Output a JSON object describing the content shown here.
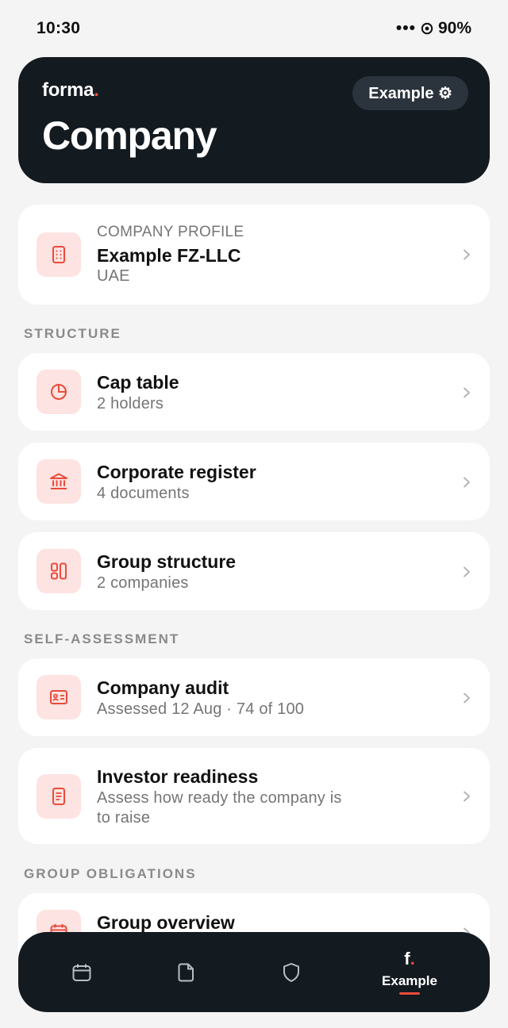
{
  "status_bar": {
    "time": "10:30",
    "dots": "•••",
    "battery": "90%"
  },
  "header": {
    "brand": "forma",
    "brand_dot": ".",
    "title": "Company",
    "workspace_button": "Example ⚙"
  },
  "company_profile": {
    "overline": "COMPANY PROFILE",
    "name": "Example FZ-LLC",
    "country": "UAE"
  },
  "sections": {
    "structure": "STRUCTURE",
    "self_assessment": "SELF-ASSESSMENT",
    "group_obligations": "GROUP OBLIGATIONS"
  },
  "structure_items": [
    {
      "title": "Cap table",
      "subtitle": "2 holders",
      "icon": "pie-chart-icon"
    },
    {
      "title": "Corporate register",
      "subtitle": "4 documents",
      "icon": "bank-icon"
    },
    {
      "title": "Group structure",
      "subtitle": "2 companies",
      "icon": "grid-icon"
    }
  ],
  "assessment_items": [
    {
      "title": "Company audit",
      "subtitle": "Assessed 12 Aug · 74 of 100",
      "icon": "id-card-icon"
    },
    {
      "title": "Investor readiness",
      "subtitle_line1": "Assess how ready the company is",
      "subtitle_line2": "to raise",
      "icon": "document-icon"
    }
  ],
  "obligation_items": [
    {
      "title": "Group overview",
      "icon": "calendar-icon"
    }
  ],
  "bottom_nav": {
    "items": [
      "calendar-icon",
      "file-icon",
      "shield-icon"
    ],
    "active_glyph": "f",
    "active_dot": ".",
    "active_label": "Example"
  },
  "colors": {
    "accent": "#ea4b3c",
    "dark": "#131a20",
    "icon_bg": "#fde3e1",
    "page_bg": "#f4f4f4"
  }
}
